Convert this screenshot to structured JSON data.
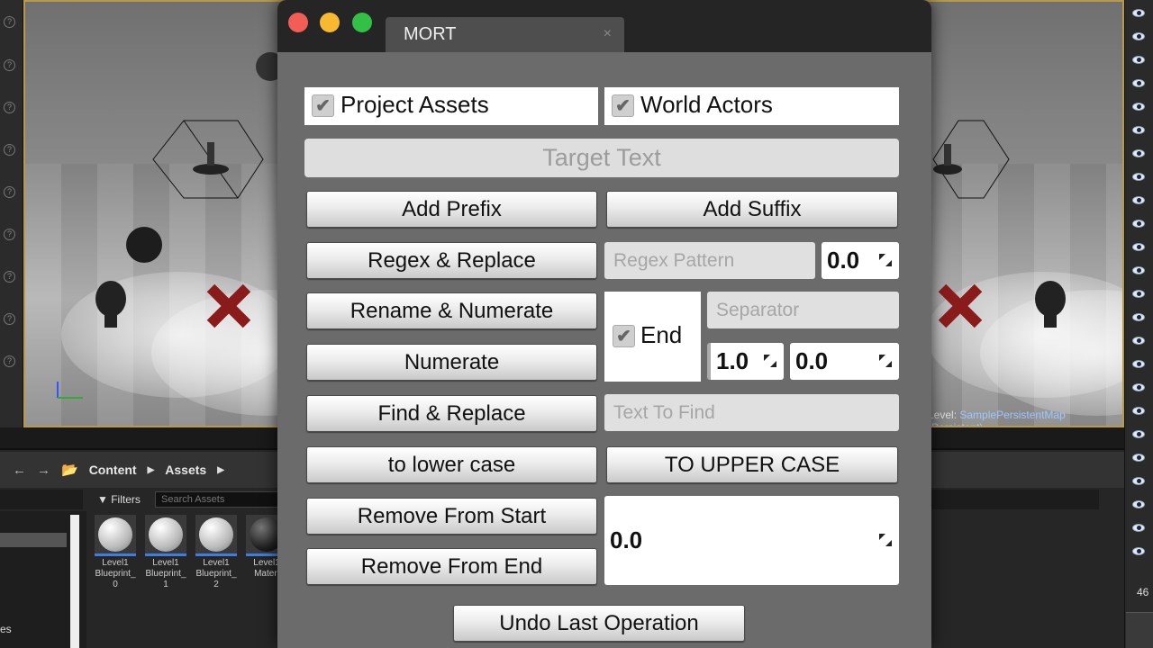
{
  "background": {
    "viewport_level_label": "Level:",
    "viewport_level_name": "SamplePersistentMap (Persistent)",
    "content_browser": {
      "breadcrumb": [
        "Content",
        "Assets"
      ],
      "filters_label": "Filters",
      "search_placeholder": "Search Assets",
      "assets": [
        {
          "line1": "Level1",
          "line2": "Blueprint_",
          "line3": "0"
        },
        {
          "line1": "Level1",
          "line2": "Blueprint_",
          "line3": "1"
        },
        {
          "line1": "Level1",
          "line2": "Blueprint_",
          "line3": "2"
        },
        {
          "line1": "Level1",
          "line2": "Materi",
          "line3": ""
        }
      ],
      "tree_label": "es"
    },
    "right_panel_count": "46"
  },
  "window": {
    "tab_title": "MORT",
    "tab_close": "×",
    "scope": {
      "project_assets_label": "Project Assets",
      "project_assets_checked": true,
      "world_actors_label": "World Actors",
      "world_actors_checked": true
    },
    "target_text_placeholder": "Target Text",
    "buttons": {
      "add_prefix": "Add Prefix",
      "add_suffix": "Add Suffix",
      "regex_replace": "Regex & Replace",
      "rename_numerate": "Rename & Numerate",
      "numerate": "Numerate",
      "find_replace": "Find & Replace",
      "lower_case": "to lower case",
      "upper_case": "TO UPPER CASE",
      "remove_start": "Remove From Start",
      "remove_end": "Remove From End",
      "undo": "Undo Last Operation"
    },
    "fields": {
      "regex_pattern_placeholder": "Regex Pattern",
      "regex_value": "0.0",
      "end_label": "End",
      "end_checked": true,
      "separator_placeholder": "Separator",
      "numerate_start": "1.0",
      "numerate_step": "0.0",
      "text_to_find_placeholder": "Text To Find",
      "remove_count": "0.0"
    },
    "check_glyph": "✔"
  }
}
